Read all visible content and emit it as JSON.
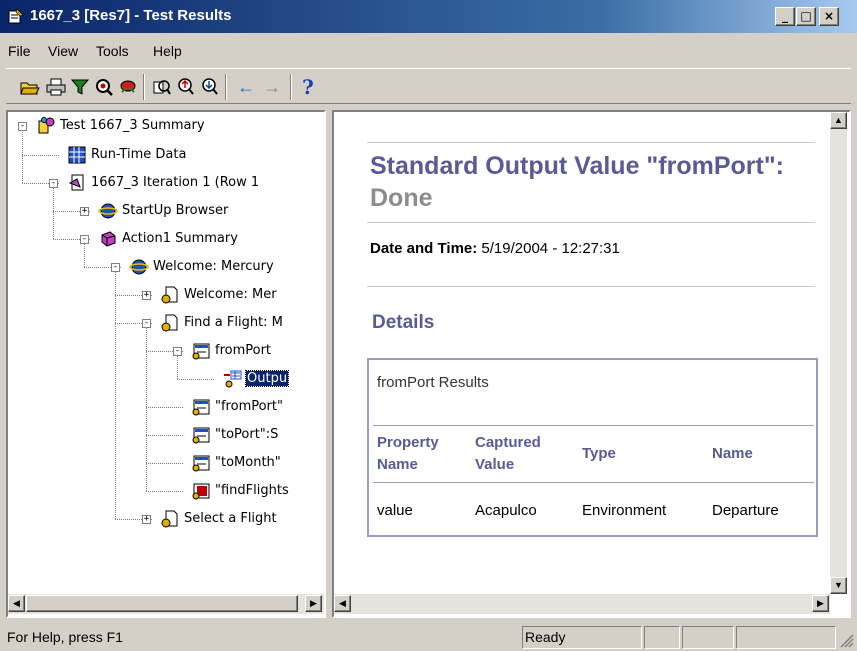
{
  "window": {
    "title": "1667_3 [Res7] - Test Results",
    "min_glyph": "_",
    "max_glyph": "□",
    "close_glyph": "×"
  },
  "menu": [
    "File",
    "View",
    "Tools",
    "Help"
  ],
  "toolbar": {
    "buttons": [
      "open-icon",
      "print-icon",
      "filter-icon",
      "find-icon",
      "bug-icon",
      "zoom-icon",
      "zoom-in-icon",
      "zoom-out-icon",
      "back-arrow-icon",
      "forward-arrow-icon",
      "help-icon"
    ],
    "help_glyph": "?",
    "back_glyph": "←",
    "forward_glyph": "→"
  },
  "tree": {
    "nodes": [
      {
        "label": "Test 1667_3 Summary",
        "icon": "test-summary-icon"
      },
      {
        "label": "Run-Time Data",
        "icon": "grid-icon"
      },
      {
        "label": "1667_3 Iteration 1 (Row 1",
        "icon": "iteration-icon"
      },
      {
        "label": "StartUp Browser",
        "icon": "browser-icon"
      },
      {
        "label": "Action1 Summary",
        "icon": "action-icon"
      },
      {
        "label": "Welcome: Mercury",
        "icon": "browser-icon"
      },
      {
        "label": "Welcome: Mer",
        "icon": "page-icon"
      },
      {
        "label": "Find a Flight: M",
        "icon": "page-icon"
      },
      {
        "label": "fromPort",
        "icon": "list-icon"
      },
      {
        "label": "Outpu",
        "icon": "output-icon"
      },
      {
        "label": "\"fromPort\"",
        "icon": "list-icon"
      },
      {
        "label": "\"toPort\":S",
        "icon": "list-icon"
      },
      {
        "label": "\"toMonth\"",
        "icon": "list-icon"
      },
      {
        "label": "\"findFlights",
        "icon": "image-icon"
      },
      {
        "label": "Select a Flight",
        "icon": "page-icon"
      }
    ],
    "selected": "Outpu"
  },
  "details": {
    "title_main": "Standard Output Value \"fromPort\":",
    "title_status": "Done",
    "datetime_label": "Date and Time:",
    "datetime_value": "5/19/2004 - 12:27:31",
    "section_heading": "Details",
    "table": {
      "caption": "fromPort Results",
      "headers": [
        "Property Name",
        "Captured Value",
        "Type",
        "Name"
      ],
      "row": [
        "value",
        "Acapulco",
        "Environment",
        "Departure"
      ]
    }
  },
  "statusbar": {
    "help": "For Help, press F1",
    "state": "Ready"
  },
  "colors": {
    "title_accent": "#5a5a96",
    "status_done": "#8c8c8c",
    "selection": "#0a246a"
  }
}
